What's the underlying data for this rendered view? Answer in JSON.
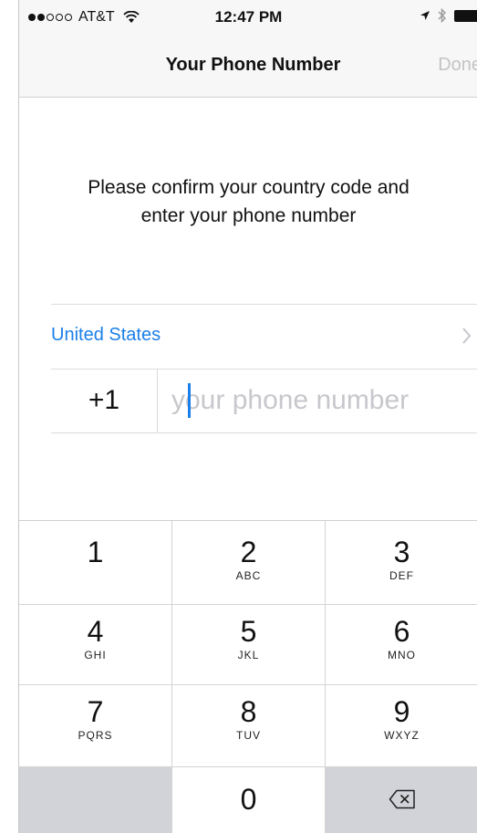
{
  "status_bar": {
    "carrier": "AT&T",
    "signal_bars": 2,
    "time": "12:47 PM",
    "icons": [
      "wifi-icon",
      "location-arrow-icon",
      "bluetooth-icon",
      "battery-icon"
    ]
  },
  "nav": {
    "title": "Your Phone Number",
    "done_label": "Done"
  },
  "instruction": "Please confirm your country code and\nenter your phone number",
  "country": {
    "name": "United States",
    "chevron_icon": "chevron-right-icon"
  },
  "phone": {
    "country_code": "+1",
    "placeholder": "your phone number",
    "value": ""
  },
  "keypad": {
    "keys": [
      {
        "digit": "1",
        "letters": ""
      },
      {
        "digit": "2",
        "letters": "ABC"
      },
      {
        "digit": "3",
        "letters": "DEF"
      },
      {
        "digit": "4",
        "letters": "GHI"
      },
      {
        "digit": "5",
        "letters": "JKL"
      },
      {
        "digit": "6",
        "letters": "MNO"
      },
      {
        "digit": "7",
        "letters": "PQRS"
      },
      {
        "digit": "8",
        "letters": "TUV"
      },
      {
        "digit": "9",
        "letters": "WXYZ"
      },
      {
        "digit": "0",
        "letters": ""
      }
    ],
    "delete_icon": "backspace-icon"
  },
  "colors": {
    "accent": "#1a7fe8",
    "disabled": "#c4c4c4",
    "keypad_gray": "#d1d3d9"
  }
}
